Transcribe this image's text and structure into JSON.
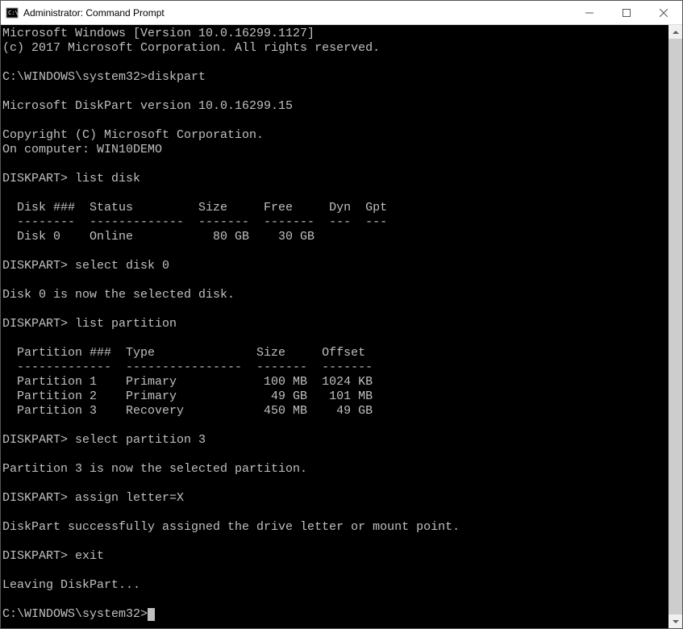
{
  "window": {
    "title": "Administrator: Command Prompt"
  },
  "banner": {
    "line1": "Microsoft Windows [Version 10.0.16299.1127]",
    "line2": "(c) 2017 Microsoft Corporation. All rights reserved."
  },
  "prompt1": {
    "path": "C:\\WINDOWS\\system32>",
    "cmd": "diskpart"
  },
  "diskpart_banner": {
    "line1": "Microsoft DiskPart version 10.0.16299.15",
    "line2": "Copyright (C) Microsoft Corporation.",
    "line3": "On computer: WIN10DEMO"
  },
  "dp1": {
    "prompt": "DISKPART>",
    "cmd": " list disk"
  },
  "disk_table": {
    "header": "  Disk ###  Status         Size     Free     Dyn  Gpt",
    "divider": "  --------  -------------  -------  -------  ---  ---",
    "row0": "  Disk 0    Online           80 GB    30 GB"
  },
  "dp2": {
    "prompt": "DISKPART>",
    "cmd": " select disk 0"
  },
  "msg1": "Disk 0 is now the selected disk.",
  "dp3": {
    "prompt": "DISKPART>",
    "cmd": " list partition"
  },
  "part_table": {
    "header": "  Partition ###  Type              Size     Offset",
    "divider": "  -------------  ----------------  -------  -------",
    "row0": "  Partition 1    Primary            100 MB  1024 KB",
    "row1": "  Partition 2    Primary             49 GB   101 MB",
    "row2": "  Partition 3    Recovery           450 MB    49 GB"
  },
  "dp4": {
    "prompt": "DISKPART>",
    "cmd": " select partition 3"
  },
  "msg2": "Partition 3 is now the selected partition.",
  "dp5": {
    "prompt": "DISKPART>",
    "cmd": " assign letter=X"
  },
  "msg3": "DiskPart successfully assigned the drive letter or mount point.",
  "dp6": {
    "prompt": "DISKPART>",
    "cmd": " exit"
  },
  "msg4": "Leaving DiskPart...",
  "prompt2": {
    "path": "C:\\WINDOWS\\system32>"
  }
}
